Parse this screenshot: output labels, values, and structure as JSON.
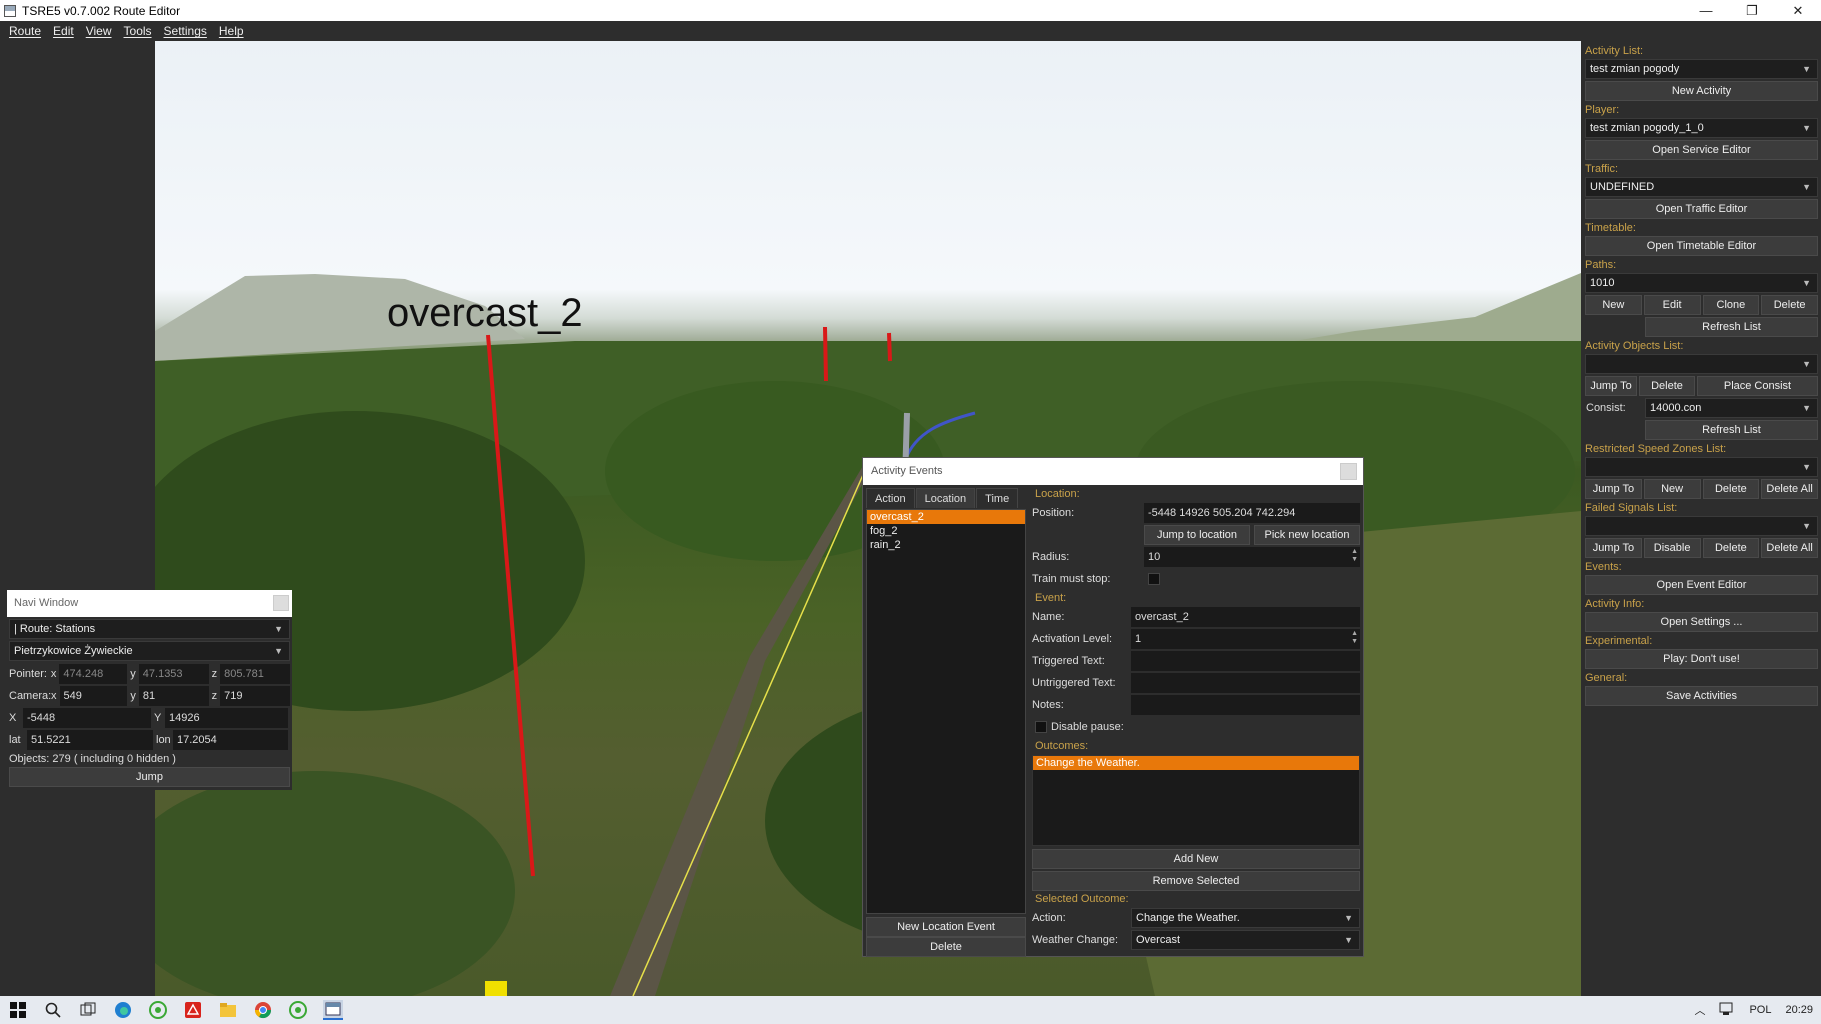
{
  "window": {
    "title": "TSRE5 v0.7.002 Route Editor",
    "minimize": "—",
    "maximize": "❐",
    "close": "✕"
  },
  "menu": [
    "Route",
    "Edit",
    "View",
    "Tools",
    "Settings",
    "Help"
  ],
  "viewport": {
    "event_marker_label": "overcast_2"
  },
  "navi": {
    "title": "Navi Window",
    "route_select": "| Route: Stations",
    "station_select": "Pietrzykowice Żywieckie",
    "pointer_label": "Pointer:",
    "pointer": {
      "x": "474.248",
      "y": "47.1353",
      "z": "805.781"
    },
    "camera_label": "Camera:",
    "camera": {
      "x": "549",
      "y": "81",
      "z": "719"
    },
    "X": "-5448",
    "Y": "14926",
    "lat": "51.5221",
    "lon": "17.2054",
    "objects": "Objects: 279 ( including 0 hidden )",
    "jump": "Jump",
    "axis": {
      "x": "x",
      "y": "y",
      "z": "z",
      "X": "X",
      "Y": "Y",
      "lat": "lat",
      "lon": "lon"
    }
  },
  "right_panel": {
    "activity_list_label": "Activity List:",
    "activity": "test zmian pogody",
    "new_activity": "New Activity",
    "player_label": "Player:",
    "player": "test zmian pogody_1_0",
    "open_service_editor": "Open Service Editor",
    "traffic_label": "Traffic:",
    "traffic": "UNDEFINED",
    "open_traffic_editor": "Open Traffic Editor",
    "timetable_label": "Timetable:",
    "open_timetable_editor": "Open Timetable Editor",
    "paths_label": "Paths:",
    "path": "1010",
    "path_buttons": [
      "New",
      "Edit",
      "Clone",
      "Delete"
    ],
    "refresh_list": "Refresh List",
    "activity_objects_label": "Activity Objects List:",
    "activity_object": "",
    "obj_buttons": [
      "Jump To",
      "Delete",
      "Place Consist"
    ],
    "consist_label": "Consist:",
    "consist": "14000.con",
    "refresh_list2": "Refresh List",
    "speed_zones_label": "Restricted Speed Zones List:",
    "speed_zone": "",
    "zone_buttons": [
      "Jump To",
      "New",
      "Delete",
      "Delete All"
    ],
    "failed_signals_label": "Failed Signals List:",
    "failed_signal": "",
    "signal_buttons": [
      "Jump To",
      "Disable",
      "Delete",
      "Delete All"
    ],
    "events_label": "Events:",
    "open_event_editor": "Open Event Editor",
    "activity_info_label": "Activity Info:",
    "open_settings": "Open Settings ...",
    "experimental_label": "Experimental:",
    "play": "Play: Don't use!",
    "general_label": "General:",
    "save_activities": "Save Activities"
  },
  "dialog": {
    "title": "Activity Events",
    "tabs": [
      "Action",
      "Location",
      "Time"
    ],
    "events": [
      "overcast_2",
      "fog_2",
      "rain_2"
    ],
    "new_location_event": "New Location Event",
    "delete": "Delete",
    "location_label": "Location:",
    "position_label": "Position:",
    "position": "-5448 14926 505.204 742.294",
    "jump_to_location": "Jump to location",
    "pick_new_location": "Pick new location",
    "radius_label": "Radius:",
    "radius": "10",
    "train_must_stop_label": "Train must stop:",
    "event_label": "Event:",
    "name_label": "Name:",
    "name": "overcast_2",
    "activation_level_label": "Activation Level:",
    "activation_level": "1",
    "triggered_text_label": "Triggered Text:",
    "triggered_text": "",
    "untriggered_text_label": "Untriggered Text:",
    "untriggered_text": "",
    "notes_label": "Notes:",
    "notes": "",
    "disable_pause_label": "Disable pause:",
    "outcomes_label": "Outcomes:",
    "outcome": "Change the Weather.",
    "add_new": "Add New",
    "remove_selected": "Remove Selected",
    "selected_outcome_label": "Selected Outcome:",
    "action_label": "Action:",
    "action": "Change the Weather.",
    "weather_change_label": "Weather Change:",
    "weather_change": "Overcast"
  },
  "taskbar": {
    "tray_lang": "POL",
    "clock": "20:29"
  },
  "colors": {
    "accent": "#e8780a",
    "section_label": "#c9a24a",
    "panel": "#2d2d2d"
  }
}
